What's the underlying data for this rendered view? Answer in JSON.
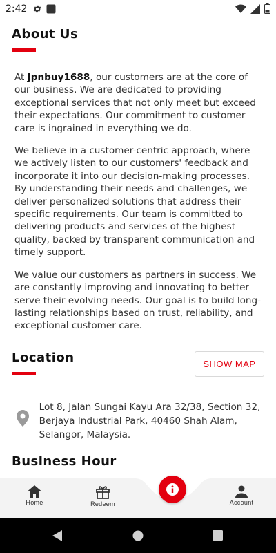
{
  "status_bar": {
    "time": "2:42",
    "left_icons": [
      "gear-icon",
      "app-square-icon"
    ],
    "right_icons": [
      "wifi-icon",
      "signal-icon",
      "battery-icon"
    ]
  },
  "about": {
    "title": "About Us",
    "p1_prefix": "At ",
    "brand": "Jpnbuy1688",
    "p1_suffix": ", our customers are at the core of our business. We are dedicated to providing exceptional services that not only meet but exceed their expectations. Our commitment to customer care is ingrained in everything we do.",
    "p2": "We believe in a customer-centric approach, where we actively listen to our customers' feedback and incorporate it into our decision-making processes. By understanding their needs and challenges, we deliver personalized solutions that address their specific requirements. Our team is committed to delivering products and services of the highest quality, backed by transparent communication and timely support.",
    "p3": "We value our customers as partners in success. We are constantly improving and innovating to better serve their evolving needs. Our goal is to build long-lasting relationships based on trust, reliability, and exceptional customer care."
  },
  "location": {
    "title": "Location",
    "show_map_label": "SHOW MAP",
    "address": "Lot 8, Jalan Sungai Kayu Ara 32/38, Section 32, Berjaya Industrial Park, 40460 Shah Alam, Selangor, Malaysia."
  },
  "business": {
    "title": "Business Hour"
  },
  "bottom_nav": {
    "items": [
      {
        "label": "Home",
        "icon": "home-icon"
      },
      {
        "label": "Redeem",
        "icon": "gift-icon"
      },
      {
        "label": "Account",
        "icon": "account-icon"
      }
    ],
    "fab_icon": "info-icon"
  },
  "colors": {
    "accent": "#e3000f",
    "nav_background": "#f3f3f3",
    "text": "#333333"
  }
}
